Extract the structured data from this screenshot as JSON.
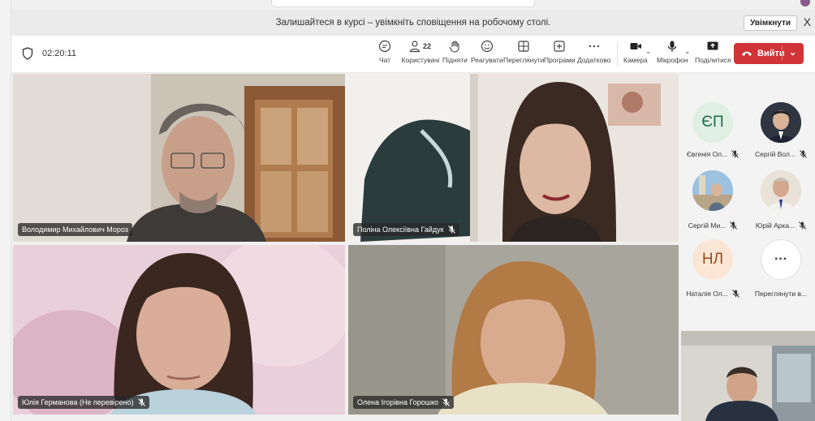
{
  "notification": {
    "text": "Залишайтеся в курсі – увімкніть сповіщення на робочому столі.",
    "button_label": "Увімкнути",
    "close_label": "X"
  },
  "toolbar": {
    "timer": "02:20:11",
    "people_count": "22",
    "items": [
      {
        "label": "Чат",
        "icon": "chat-icon"
      },
      {
        "label": "Користувачі",
        "icon": "people-icon"
      },
      {
        "label": "Підняти",
        "icon": "raise-hand-icon"
      },
      {
        "label": "Реагувати",
        "icon": "react-icon"
      },
      {
        "label": "Переглянути",
        "icon": "view-icon"
      },
      {
        "label": "Програми",
        "icon": "apps-icon"
      },
      {
        "label": "Додатково",
        "icon": "more-icon"
      },
      {
        "label": "Камера",
        "icon": "camera-icon"
      },
      {
        "label": "Мікрофон",
        "icon": "mic-icon"
      },
      {
        "label": "Поділитися",
        "icon": "share-icon"
      }
    ],
    "leave_label": "Вийти"
  },
  "participants": [
    {
      "name": "Володимир Михайлович Мороз"
    },
    {
      "name": "Поліна Олексіївна Гайдук"
    },
    {
      "name": "Юлія Германова (Не перевірено)"
    },
    {
      "name": "Олена Ігорівна Горошко"
    }
  ],
  "gallery": [
    {
      "name": "Євгенія Ол...",
      "initials": "ЄП"
    },
    {
      "name": "Сергій Вол..."
    },
    {
      "name": "Сергій Ми..."
    },
    {
      "name": "Юрій Арка..."
    },
    {
      "name": "Наталія Ол...",
      "initials": "НЛ"
    },
    {
      "name": "Переглянути в...",
      "initials": "···"
    }
  ],
  "colors": {
    "leave": "#d13438",
    "initials_bg": "#dff0e3",
    "initials_fg": "#1e6b46",
    "nl_bg": "#fbe6d6",
    "nl_fg": "#9a4a18"
  }
}
